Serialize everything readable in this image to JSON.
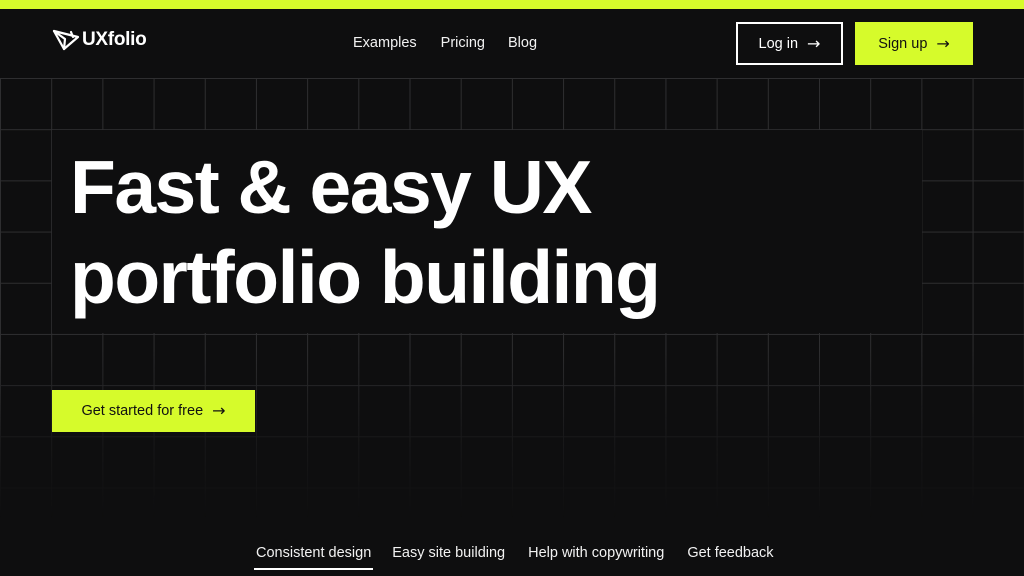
{
  "brand": {
    "name": "UXfolio",
    "icon": "paper-plane-logo-icon",
    "accent_color": "#d6fb2b",
    "background_color": "#0e0e0f"
  },
  "nav": {
    "items": [
      {
        "label": "Examples"
      },
      {
        "label": "Pricing"
      },
      {
        "label": "Blog"
      }
    ]
  },
  "header_actions": {
    "login_label": "Log in",
    "signup_label": "Sign up",
    "arrow_icon": "arrow-right-icon",
    "arrow_glyph": "→"
  },
  "hero": {
    "headline_line1": "Fast & easy UX",
    "headline_line2": "portfolio building",
    "cta_label": "Get started for free"
  },
  "feature_tabs": {
    "active_index": 0,
    "items": [
      {
        "label": "Consistent design"
      },
      {
        "label": "Easy site building"
      },
      {
        "label": "Help with copywriting"
      },
      {
        "label": "Get feedback"
      }
    ]
  }
}
